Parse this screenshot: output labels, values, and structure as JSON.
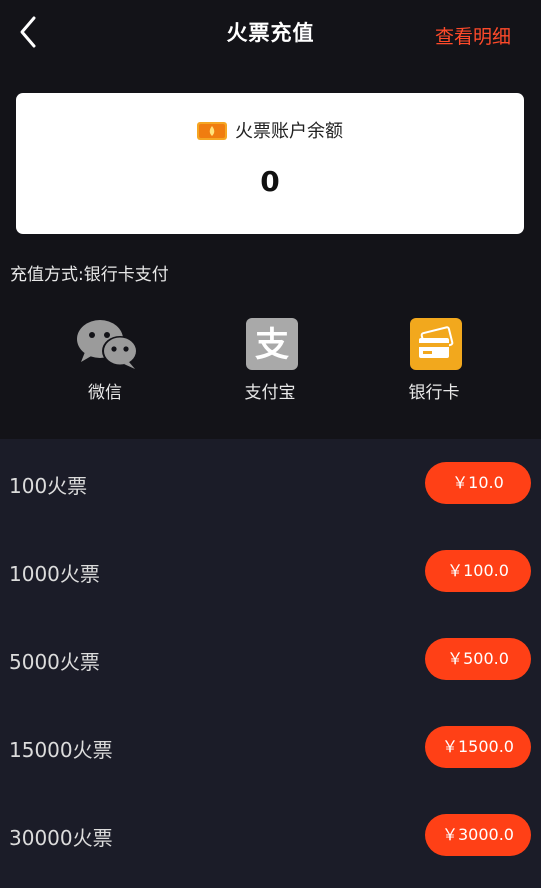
{
  "header": {
    "title": "火票充值",
    "detail_link": "查看明细"
  },
  "balance": {
    "label": "火票账户余额",
    "value": "0"
  },
  "payment": {
    "method_text": "充值方式:银行卡支付",
    "options": [
      {
        "label": "微信",
        "icon": "wechat-icon"
      },
      {
        "label": "支付宝",
        "icon": "alipay-icon"
      },
      {
        "label": "银行卡",
        "icon": "bank-card-icon"
      }
    ]
  },
  "packages": [
    {
      "name": "100火票",
      "price": "￥10.0"
    },
    {
      "name": "1000火票",
      "price": "￥100.0"
    },
    {
      "name": "5000火票",
      "price": "￥500.0"
    },
    {
      "name": "15000火票",
      "price": "￥1500.0"
    },
    {
      "name": "30000火票",
      "price": "￥3000.0"
    }
  ],
  "colors": {
    "background": "#131318",
    "list_background": "#1b1c28",
    "accent": "#ff4016",
    "link": "#ff4a2a",
    "bank_icon": "#f2a81d",
    "alipay_icon": "#a9a9a9"
  }
}
